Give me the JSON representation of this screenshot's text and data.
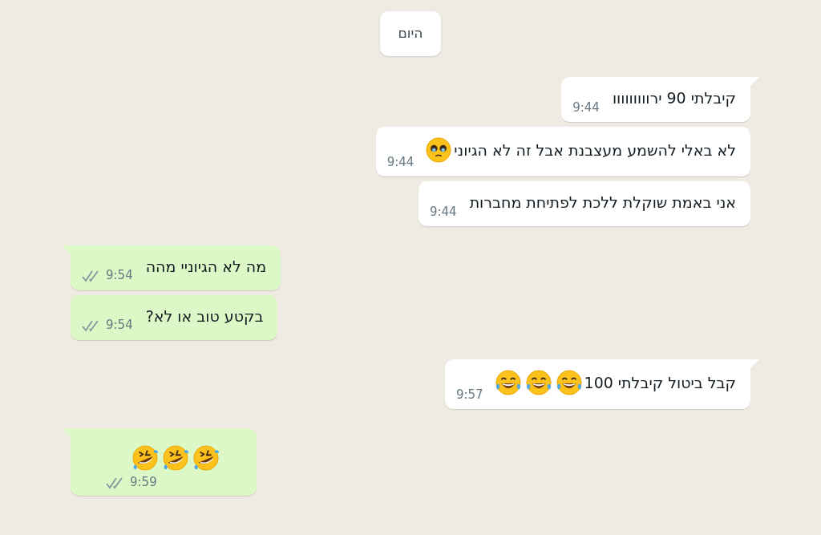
{
  "date_chip": "היום",
  "messages": [
    {
      "outgoing": true,
      "tail": true,
      "text": "קיבלתי 90 ירווווווווו",
      "time": "9:44"
    },
    {
      "outgoing": true,
      "tail": false,
      "text": "לא באלי להשמע מעצבנת אבל זה לא הגיוני",
      "emoji": [
        {
          "kind": "pleading"
        }
      ],
      "time": "9:44"
    },
    {
      "outgoing": true,
      "tail": false,
      "text": "אני באמת שוקלת ללכת לפתיחת מחברות",
      "time": "9:44"
    },
    {
      "outgoing": false,
      "tail": true,
      "text": "מה לא הגיוניי מהה",
      "time": "9:54",
      "read": false
    },
    {
      "outgoing": false,
      "tail": false,
      "text": "בקטע טוב או לא?",
      "time": "9:54",
      "read": false
    },
    {
      "outgoing": true,
      "tail": true,
      "text": "קבל ביטול קיבלתי 100",
      "emoji": [
        {
          "kind": "joy"
        },
        {
          "kind": "joy"
        },
        {
          "kind": "joy"
        }
      ],
      "time": "9:57"
    },
    {
      "outgoing": false,
      "tail": true,
      "emoji": [
        {
          "kind": "rofl"
        },
        {
          "kind": "rofl"
        },
        {
          "kind": "rofl"
        }
      ],
      "time": "9:59",
      "read": false
    }
  ]
}
